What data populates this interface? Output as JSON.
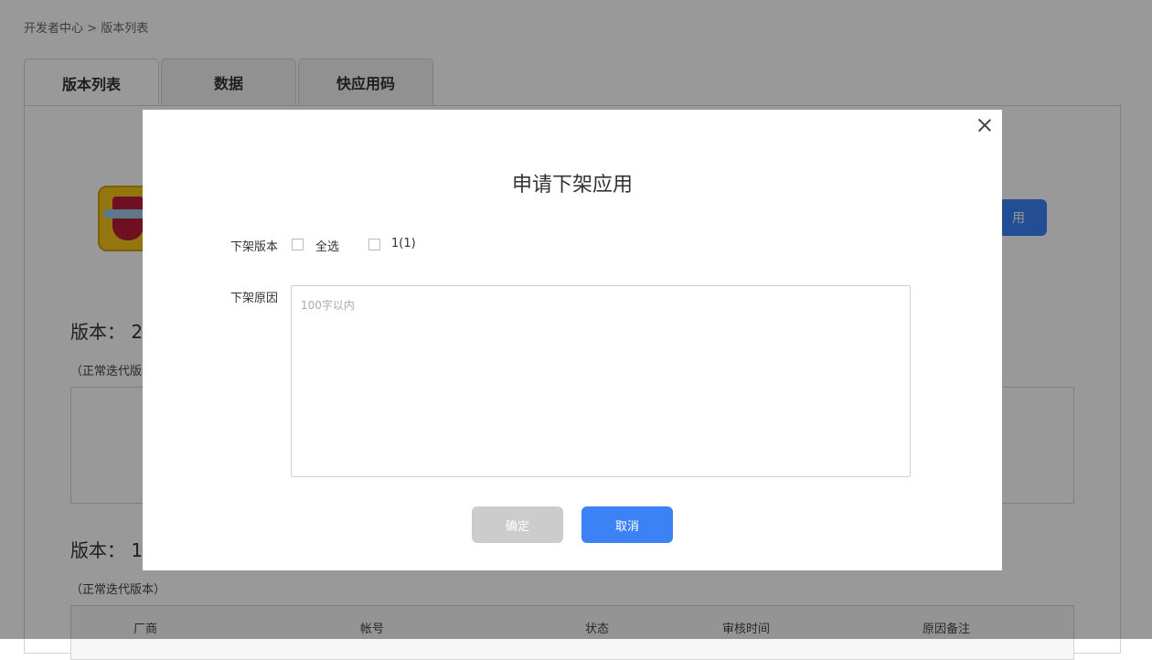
{
  "breadcrumb": {
    "home": "开发者中心",
    "sep": ">",
    "current": "版本列表"
  },
  "tabs": [
    {
      "label": "版本列表"
    },
    {
      "label": "数据"
    },
    {
      "label": "快应用码"
    }
  ],
  "background": {
    "button_label_partial": "用",
    "version_sections": [
      {
        "title": "版本： 2",
        "subtitle": "（正常迭代版"
      },
      {
        "title": "版本： 1",
        "subtitle": "（正常迭代版本）"
      }
    ],
    "table_headers": [
      "厂商",
      "帐号",
      "状态",
      "审核时间",
      "原因备注"
    ]
  },
  "modal": {
    "title": "申请下架应用",
    "version_label": "下架版本",
    "options": [
      {
        "label": "全选",
        "checked": false
      },
      {
        "label": "1(1)",
        "checked": false
      }
    ],
    "reason_label": "下架原因",
    "reason_value": "",
    "reason_placeholder": "100字以内",
    "confirm_label": "确定",
    "cancel_label": "取消"
  },
  "colors": {
    "primary": "#3b82f6",
    "disabled": "#cccccc",
    "overlay": "rgba(0,0,0,0.4)"
  }
}
